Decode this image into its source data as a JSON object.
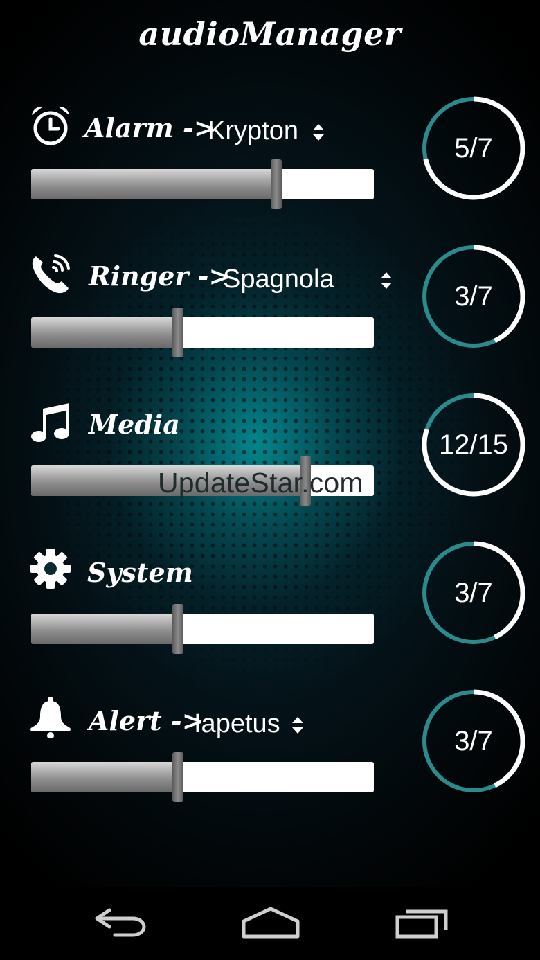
{
  "app": {
    "title": "audioManager"
  },
  "streams": [
    {
      "id": "alarm",
      "label": "Alarm",
      "arrow": "->",
      "sound": "Krypton",
      "level": 5,
      "max": 7,
      "ring_text": "5/7",
      "icon": "alarm-clock-icon"
    },
    {
      "id": "ringer",
      "label": "Ringer",
      "arrow": "->",
      "sound": "Spagnola",
      "level": 3,
      "max": 7,
      "ring_text": "3/7",
      "icon": "phone-ringing-icon"
    },
    {
      "id": "media",
      "label": "Media",
      "arrow": "",
      "sound": "",
      "level": 12,
      "max": 15,
      "ring_text": "12/15",
      "icon": "music-note-icon"
    },
    {
      "id": "system",
      "label": "System",
      "arrow": "",
      "sound": "",
      "level": 3,
      "max": 7,
      "ring_text": "3/7",
      "icon": "gear-icon"
    },
    {
      "id": "alert",
      "label": "Alert",
      "arrow": "->",
      "sound": "Iapetus",
      "level": 3,
      "max": 7,
      "ring_text": "3/7",
      "icon": "bell-icon"
    }
  ],
  "watermark": "UpdateStar.com",
  "navbar": {
    "icons": [
      "back-icon",
      "home-icon",
      "recent-apps-icon"
    ]
  },
  "colors": {
    "ring_active": "#ffffff",
    "ring_inactive": "#2a8a8c",
    "glow": "#00d2d7"
  }
}
